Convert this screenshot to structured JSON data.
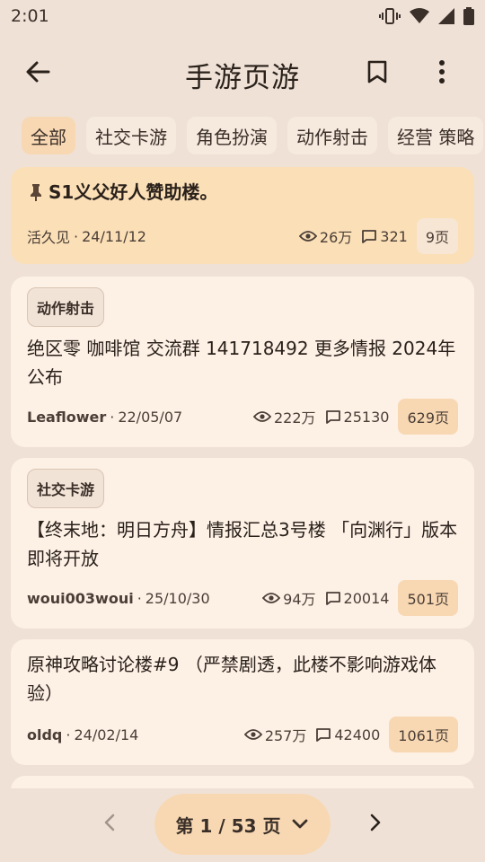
{
  "status": {
    "time": "2:01"
  },
  "header": {
    "title": "手游页游"
  },
  "chips": [
    "全部",
    "社交卡游",
    "角色扮演",
    "动作射击",
    "经营 策略"
  ],
  "threads": [
    {
      "pinned": true,
      "tag": "",
      "title": "S1义父好人赞助楼。",
      "author": "活久见",
      "date": "24/11/12",
      "views": "26万",
      "replies": "321",
      "pages": "9页"
    },
    {
      "pinned": false,
      "tag": "动作射击",
      "title": "绝区零 咖啡馆 交流群 141718492 更多情报 2024年公布",
      "author": "Leaflower",
      "date": "22/05/07",
      "views": "222万",
      "replies": "25130",
      "pages": "629页"
    },
    {
      "pinned": false,
      "tag": "社交卡游",
      "title": "【终末地：明日方舟】情报汇总3号楼 「向渊行」版本即将开放",
      "author": "woui003woui",
      "date": "25/10/30",
      "views": "94万",
      "replies": "20014",
      "pages": "501页"
    },
    {
      "pinned": false,
      "tag": "",
      "title": "原神攻略讨论楼#9 （严禁剧透，此楼不影响游戏体验）",
      "author": "oldq",
      "date": "24/02/14",
      "views": "257万",
      "replies": "42400",
      "pages": "1061页"
    }
  ],
  "pagination": {
    "label": "第 1 / 53 页"
  },
  "separator": "·"
}
